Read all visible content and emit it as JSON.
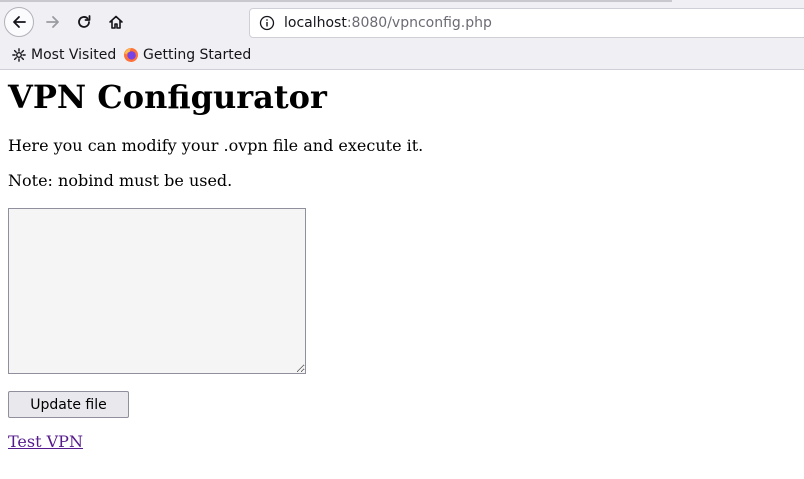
{
  "browser": {
    "url_host": "localhost",
    "url_path": ":8080/vpnconfig.php",
    "bookmarks": [
      {
        "label": "Most Visited",
        "icon": "gear-icon"
      },
      {
        "label": "Getting Started",
        "icon": "firefox-icon"
      }
    ]
  },
  "page": {
    "title": "VPN Configurator",
    "intro": "Here you can modify your .ovpn file and execute it.",
    "note": "Note: nobind must be used.",
    "config_text": "",
    "update_button": "Update file",
    "test_link": "Test VPN"
  },
  "colors": {
    "link_visited": "#551a8b",
    "chrome_bg": "#f0f0f4",
    "textarea_bg": "#f5f5f5"
  }
}
